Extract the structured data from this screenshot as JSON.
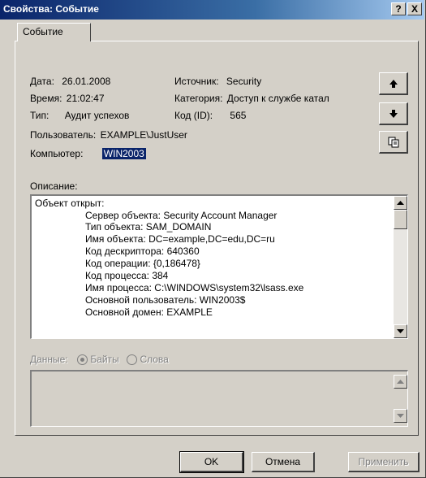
{
  "window": {
    "title": "Свойства: Событие"
  },
  "titlebar_buttons": {
    "help": "?",
    "close": "X"
  },
  "tabs": [
    {
      "label": "Событие"
    }
  ],
  "event": {
    "date_label": "Дата:",
    "date_value": "26.01.2008",
    "time_label": "Время:",
    "time_value": "21:02:47",
    "type_label": "Тип:",
    "type_value": "Аудит успехов",
    "user_label": "Пользователь:",
    "user_value": "EXAMPLE\\JustUser",
    "computer_label": "Компьютер:",
    "computer_value": "WIN2003",
    "source_label": "Источник:",
    "source_value": "Security",
    "category_label": "Категория:",
    "category_value": "Доступ к службе катал",
    "id_label": "Код (ID):",
    "id_value": "565"
  },
  "description": {
    "label": "Описание:",
    "lines": [
      "Объект открыт:",
      "Сервер объекта:   Security Account Manager",
      "Тип объекта:         SAM_DOMAIN",
      "Имя объекта:         DC=example,DC=edu,DC=ru",
      "Код дескриптора: 640360",
      "Код операции:       {0,186478}",
      "Код процесса:        384",
      "Имя процесса:        C:\\WINDOWS\\system32\\lsass.exe",
      "Основной пользователь:      WIN2003$",
      "Основной домен:  EXAMPLE"
    ]
  },
  "data_section": {
    "label": "Данные:",
    "bytes_label": "Байты",
    "words_label": "Слова",
    "selected": "bytes"
  },
  "buttons": {
    "ok": "OK",
    "cancel": "Отмена",
    "apply": "Применить"
  },
  "icons": {
    "up": "arrow-up-icon",
    "down": "arrow-down-icon",
    "copy": "copy-icon"
  }
}
